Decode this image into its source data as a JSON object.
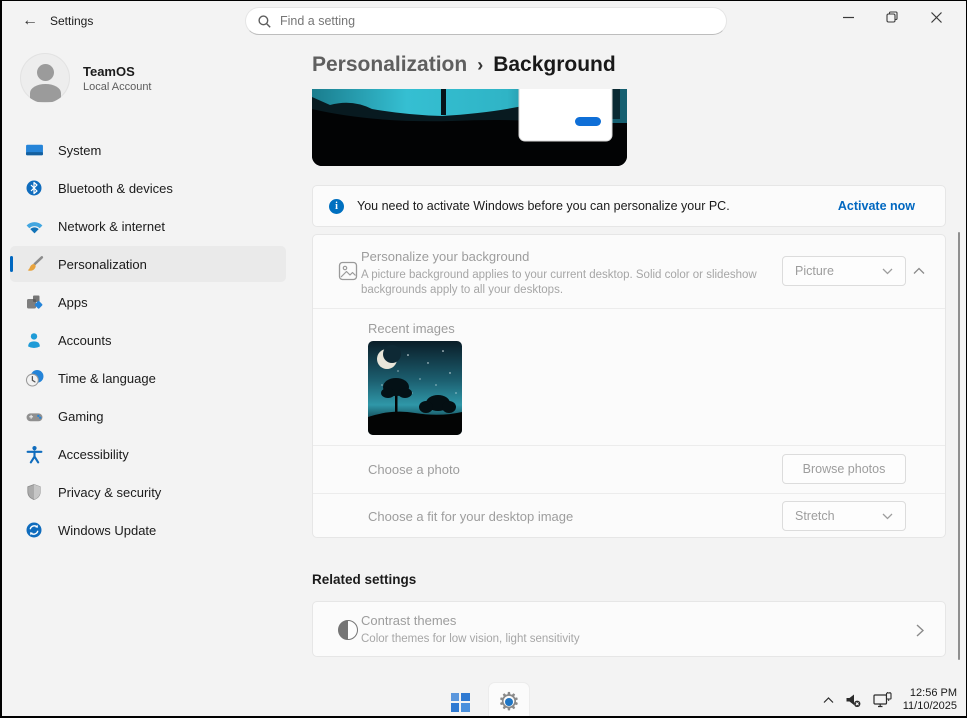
{
  "window": {
    "title": "Settings",
    "search_placeholder": "Find a setting"
  },
  "user": {
    "name": "TeamOS",
    "subtitle": "Local Account"
  },
  "sidebar": {
    "items": [
      {
        "label": "System",
        "icon": "system-icon"
      },
      {
        "label": "Bluetooth & devices",
        "icon": "bluetooth-icon"
      },
      {
        "label": "Network & internet",
        "icon": "network-icon"
      },
      {
        "label": "Personalization",
        "icon": "personalization-icon",
        "selected": true
      },
      {
        "label": "Apps",
        "icon": "apps-icon"
      },
      {
        "label": "Accounts",
        "icon": "accounts-icon"
      },
      {
        "label": "Time & language",
        "icon": "time-language-icon"
      },
      {
        "label": "Gaming",
        "icon": "gaming-icon"
      },
      {
        "label": "Accessibility",
        "icon": "accessibility-icon"
      },
      {
        "label": "Privacy & security",
        "icon": "privacy-icon"
      },
      {
        "label": "Windows Update",
        "icon": "windows-update-icon"
      }
    ]
  },
  "breadcrumb": {
    "parent": "Personalization",
    "separator": "›",
    "current": "Background"
  },
  "banner": {
    "message": "You need to activate Windows before you can personalize your PC.",
    "action_label": "Activate now"
  },
  "background": {
    "title": "Personalize your background",
    "description": "A picture background applies to your current desktop. Solid color or slideshow backgrounds apply to all your desktops.",
    "type_value": "Picture",
    "recent_label": "Recent images",
    "photo_label": "Choose a photo",
    "browse_label": "Browse photos",
    "fit_label": "Choose a fit for your desktop image",
    "fit_value": "Stretch"
  },
  "related": {
    "heading": "Related settings",
    "contrast_title": "Contrast themes",
    "contrast_description": "Color themes for low vision, light sensitivity"
  },
  "taskbar": {
    "time": "12:56 PM",
    "date": "11/10/2025"
  },
  "colors": {
    "accent": "#0067c0",
    "page_bg": "#f3f3f3",
    "card_bg": "#fbfbfb",
    "card_border": "#e6e6e6",
    "disabled_text": "#9d9d9d",
    "selected_nav_bg": "#eaeaea"
  }
}
